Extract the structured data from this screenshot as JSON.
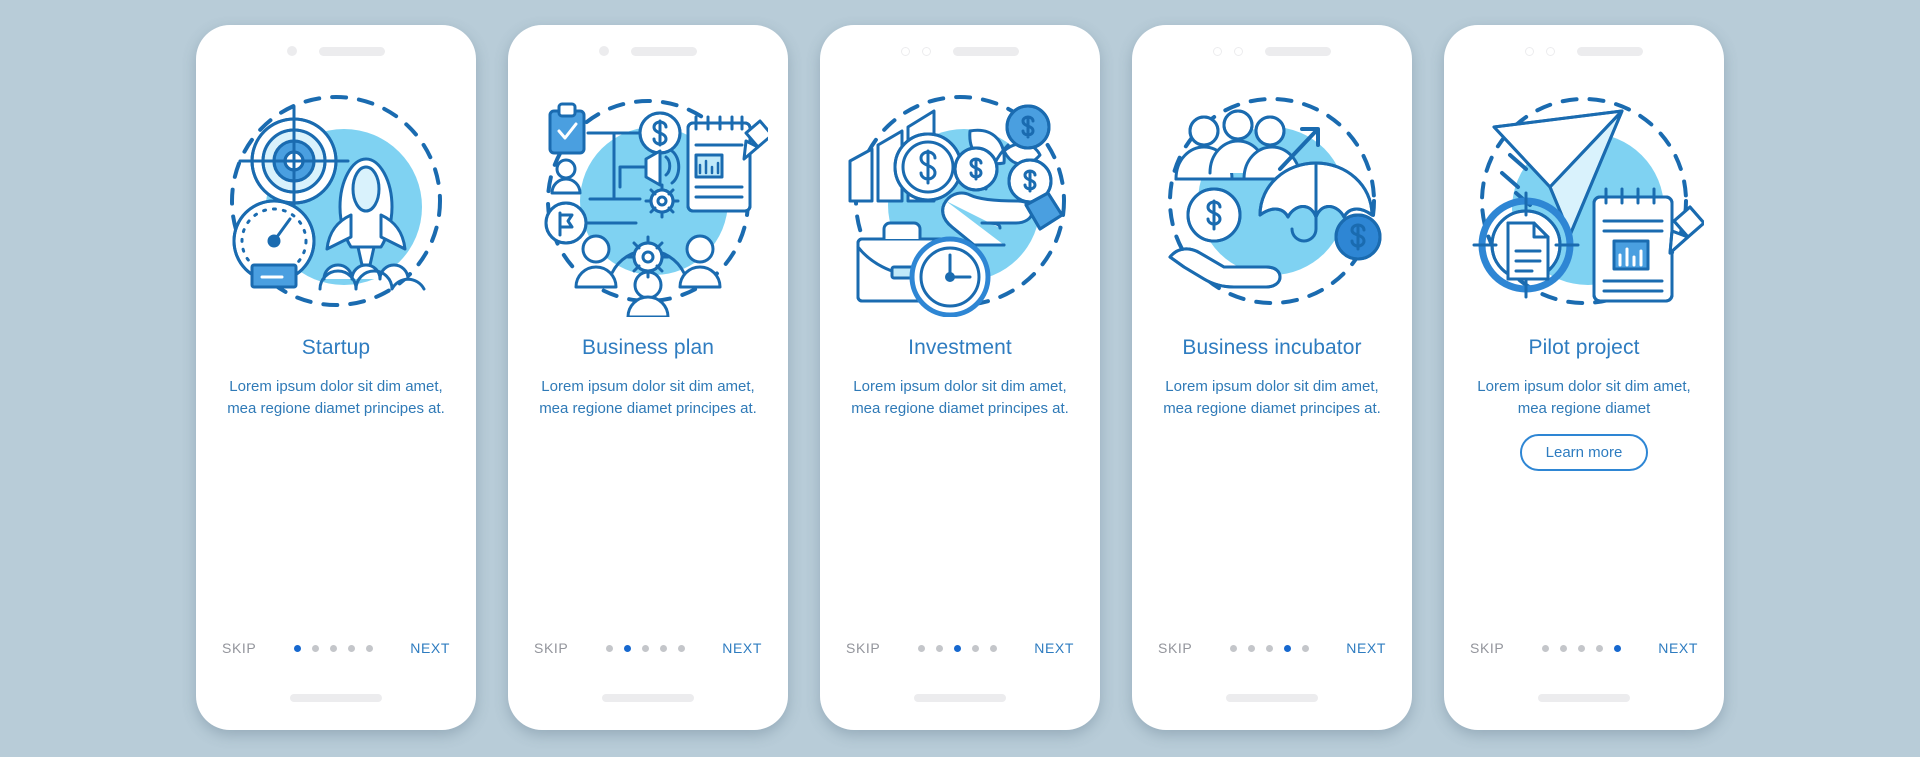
{
  "theme": {
    "background": "#b8ccd8",
    "card_background": "#ffffff",
    "accent_blue": "#2e7cc0",
    "active_dot": "#1668cf",
    "inactive_dot": "#c4c6ca",
    "skip_gray": "#93959c",
    "illustration_line": "#1a6bb0",
    "illustration_fill": "#7fd2f2",
    "illustration_fill_light": "#bfe9f9"
  },
  "nav_labels": {
    "skip": "SKIP",
    "next": "NEXT"
  },
  "screens": [
    {
      "title": "Startup",
      "body": "Lorem ipsum dolor sit dim amet, mea regione diamet principes at.",
      "icon": "startup-rocket-target-illustration",
      "active_index": 0,
      "total_dots": 5,
      "statusbar": "dot-bar",
      "cta": null
    },
    {
      "title": "Business plan",
      "body": "Lorem ipsum dolor sit dim amet, mea regione diamet principes at.",
      "icon": "business-plan-flowchart-illustration",
      "active_index": 1,
      "total_dots": 5,
      "statusbar": "dot-bar",
      "cta": null
    },
    {
      "title": "Investment",
      "body": "Lorem ipsum dolor sit dim amet, mea regione diamet principes at.",
      "icon": "investment-hand-money-plant-illustration",
      "active_index": 2,
      "total_dots": 5,
      "statusbar": "two-rings-bar",
      "cta": null
    },
    {
      "title": "Business incubator",
      "body": "Lorem ipsum dolor sit dim amet, mea regione diamet principes at.",
      "icon": "business-incubator-umbrella-illustration",
      "active_index": 3,
      "total_dots": 5,
      "statusbar": "two-rings-bar",
      "cta": null
    },
    {
      "title": "Pilot project",
      "body": "Lorem ipsum dolor sit dim amet, mea regione diamet",
      "icon": "pilot-project-paper-plane-illustration",
      "active_index": 4,
      "total_dots": 5,
      "statusbar": "two-rings-bar",
      "cta": "Learn more"
    }
  ]
}
